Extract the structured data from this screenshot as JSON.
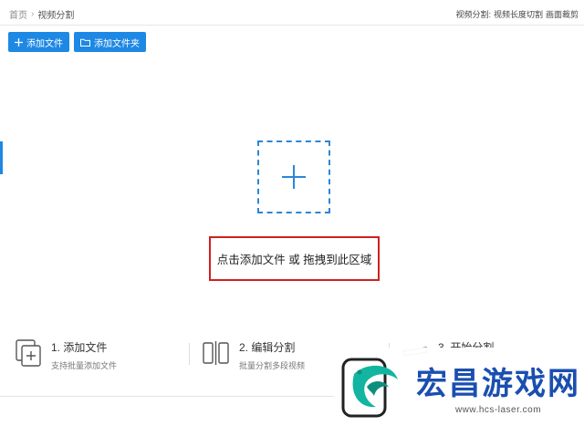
{
  "breadcrumb": {
    "home": "首页",
    "separator": "›",
    "current": "视频分割"
  },
  "mode": {
    "prefix": "视频分割:",
    "option_a": "视频长度切割",
    "option_b": "画面裁剪"
  },
  "toolbar": {
    "add_file": "添加文件",
    "add_folder": "添加文件夹"
  },
  "dropzone": {
    "hint": "点击添加文件 或 拖拽到此区域"
  },
  "steps": [
    {
      "title": "1. 添加文件",
      "desc": "支持批量添加文件"
    },
    {
      "title": "2. 编辑分割",
      "desc": "批量分割多段视频"
    },
    {
      "title": "3. 开始分割",
      "desc": ""
    }
  ],
  "watermark": {
    "title": "宏昌游戏网",
    "url": "www.hcs-laser.com"
  },
  "colors": {
    "accent": "#1e88e5",
    "highlight_border": "#d11f1f",
    "watermark_blue": "#1a4fb0",
    "logo_teal": "#11b5a0"
  }
}
